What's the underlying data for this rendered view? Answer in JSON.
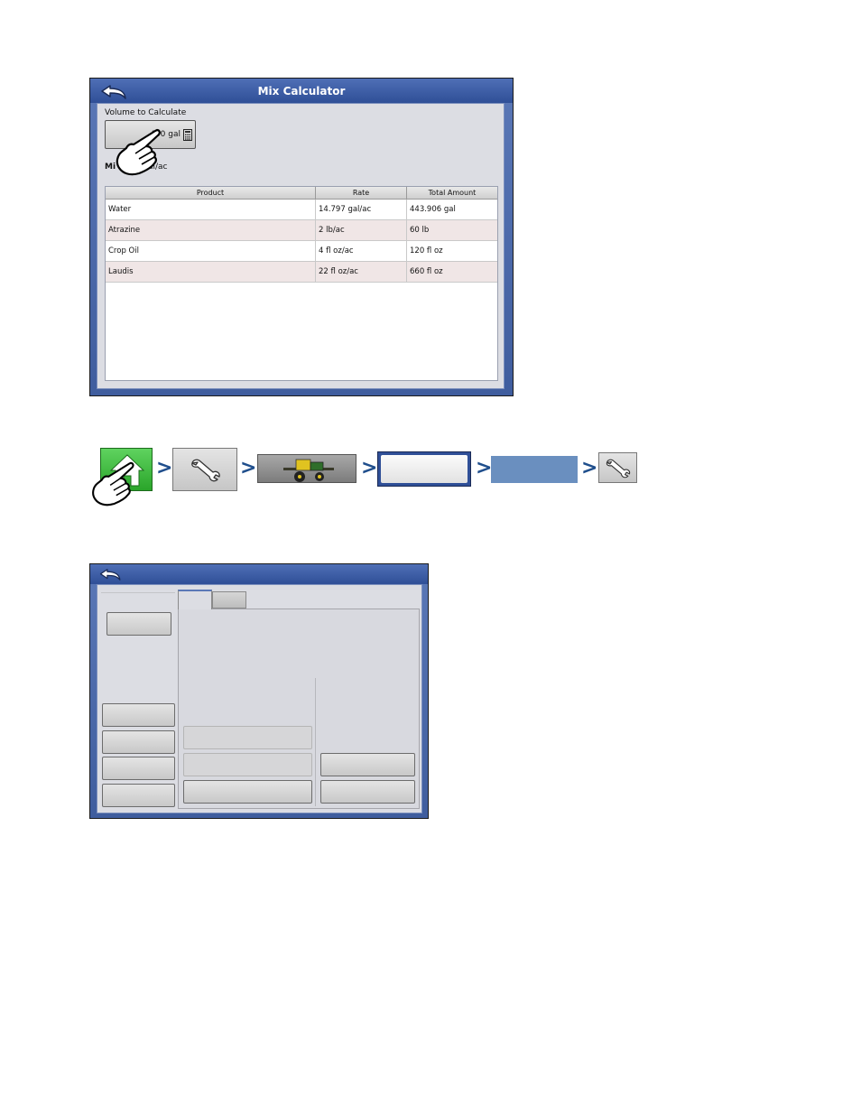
{
  "mix_calculator": {
    "title": "Mix Calculator",
    "volume_label": "Volume to Calculate",
    "volume_value": "450 gal",
    "mix_rate_label": "Mi",
    "mix_rate_value": ": 15 gal/ac",
    "table": {
      "headers": [
        "Product",
        "Rate",
        "Total Amount"
      ],
      "rows": [
        [
          "Water",
          "14.797 gal/ac",
          "443.906 gal"
        ],
        [
          "Atrazine",
          "2 lb/ac",
          "60 lb"
        ],
        [
          "Crop Oil",
          "4 fl oz/ac",
          "120 fl oz"
        ],
        [
          "Laudis",
          "22 fl oz/ac",
          "660 fl oz"
        ]
      ]
    }
  },
  "navigation_path": {
    "separator": ">",
    "steps": [
      "home-icon",
      "wrench-icon",
      "sprayer-image",
      "blank-button",
      "blue-tab",
      "wrench-icon"
    ]
  },
  "colors": {
    "titlebar": "#2f4f97",
    "home_green": "#3cb43c",
    "chevron": "#1f4e8c",
    "tab_blue": "#6a8fbf"
  }
}
